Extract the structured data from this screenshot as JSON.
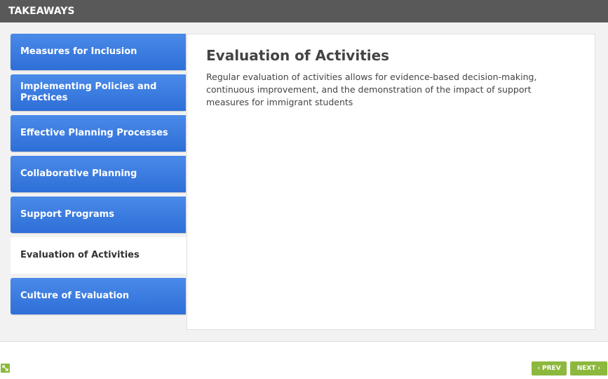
{
  "header": {
    "title": "TAKEAWAYS"
  },
  "tabs": [
    {
      "label": "Measures for Inclusion"
    },
    {
      "label": "Implementing Policies and Practices"
    },
    {
      "label": "Effective Planning Processes"
    },
    {
      "label": "Collaborative Planning"
    },
    {
      "label": "Support Programs"
    },
    {
      "label": "Evaluation of Activities"
    },
    {
      "label": "Culture of Evaluation"
    }
  ],
  "active_tab": "Evaluation of Activities",
  "panel": {
    "title": "Evaluation of Activities",
    "body": "Regular evaluation of activities allows for evidence-based decision-making, continuous improvement, and the demonstration of the impact of support measures for immigrant students"
  },
  "footer": {
    "prev_label": "PREV",
    "next_label": "NEXT",
    "accent_color": "#8db83e",
    "expand_icon": "expand-icon"
  }
}
